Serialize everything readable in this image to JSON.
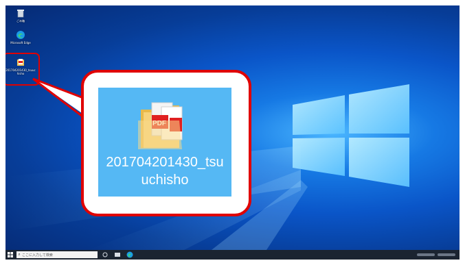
{
  "desktop": {
    "icons": [
      {
        "name": "recycle-bin",
        "label": "ごみ箱"
      },
      {
        "name": "microsoft-edge",
        "label": "Microsoft Edge"
      },
      {
        "name": "pdf-file-small",
        "label": "201704201430_tsuuchisho"
      }
    ]
  },
  "callout": {
    "label_line1": "201704201430_tsu",
    "label_line2": "uchisho",
    "accent_color": "#e00000"
  },
  "taskbar": {
    "search_placeholder": "ここに入力して検索",
    "start_icon": "windows-start-icon",
    "edge_icon": "edge-icon"
  },
  "colors": {
    "wallpaper": "#0a55c8",
    "highlight": "#e00000",
    "selection": "#55b8f4",
    "taskbar": "#1b2431"
  }
}
